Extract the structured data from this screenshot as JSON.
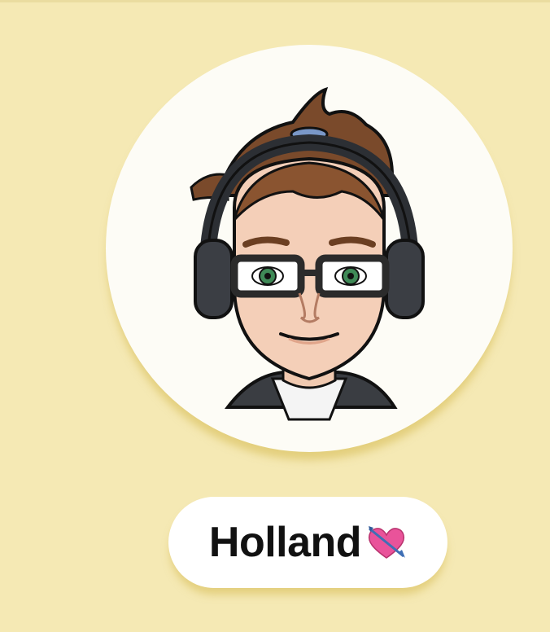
{
  "profile": {
    "display_name": "Holland",
    "name_emoji": "heart-with-arrow",
    "avatar": "bitmoji-avatar-headphones-glasses"
  },
  "colors": {
    "background": "#f5e9b4",
    "avatar_circle": "#fdfcf6",
    "pill": "#ffffff",
    "heart": "#e9539a",
    "arrow": "#3f6fb5"
  }
}
